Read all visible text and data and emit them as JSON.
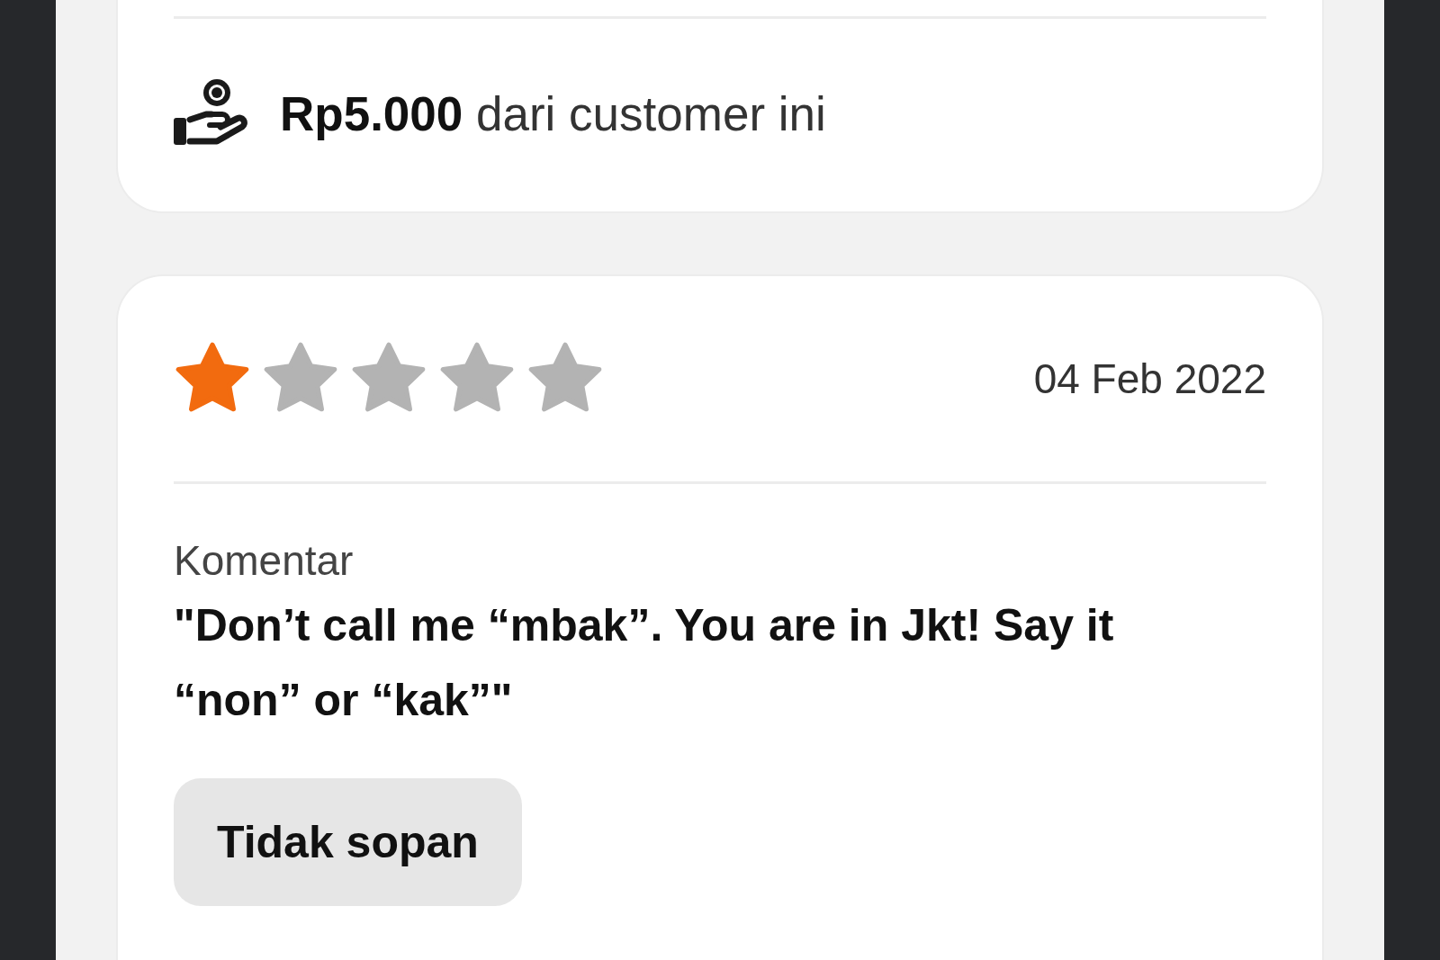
{
  "earnings": {
    "text": "**Rp5.000** dari customer ini"
  },
  "review": {
    "stars": 1,
    "date": "04 Feb 2022",
    "comment_label": "Komentar",
    "comment": "\"Don’t call me “mbak”. You are in Jkt! Say it “non” or “kak”\"",
    "tags": [
      "Tidak sopan"
    ]
  }
}
